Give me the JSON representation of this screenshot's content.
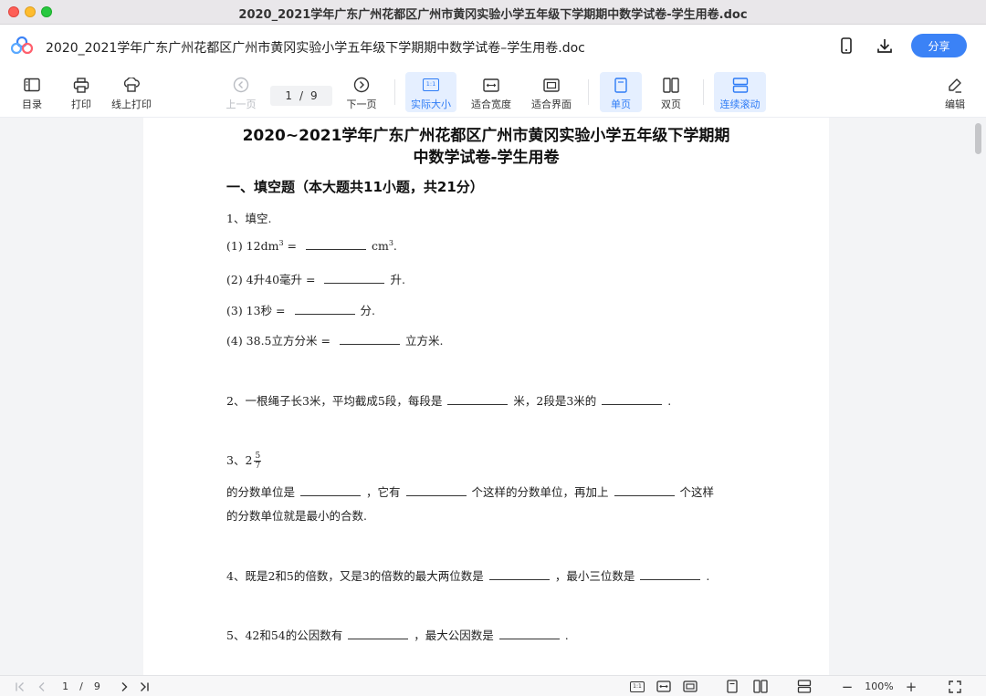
{
  "window": {
    "title": "2020_2021学年广东广州花都区广州市黄冈实验小学五年级下学期期中数学试卷-学生用卷.doc"
  },
  "header": {
    "doc_title": "2020_2021学年广东广州花都区广州市黄冈实验小学五年级下学期期中数学试卷–学生用卷.doc",
    "share_label": "分享",
    "accent": "#3b82f6"
  },
  "toolbar": {
    "toc_label": "目录",
    "print_label": "打印",
    "online_print_label": "线上打印",
    "prev_label": "上一页",
    "current_page": "1",
    "slash": "/",
    "total_pages": "9",
    "next_label": "下一页",
    "actual_size_label": "实际大小",
    "actual_size_badge": "1:1",
    "fit_width_label": "适合宽度",
    "fit_page_label": "适合界面",
    "single_page_label": "单页",
    "double_page_label": "双页",
    "continuous_label": "连续滚动",
    "edit_label": "编辑"
  },
  "document": {
    "title_line1": "2020~2021学年广东广州花都区广州市黄冈实验小学五年级下学期期",
    "title_line2": "中数学试卷-学生用卷",
    "section1": "一、填空题（本大题共11小题，共21分）",
    "q1": "1、填空.",
    "q1_1_pre": "(1) 12dm",
    "q1_1_sup": "3",
    "q1_1_eq": " = ",
    "q1_1_unit": "cm",
    "q1_1_unit_sup": "3",
    "q1_1_end": ".",
    "q1_2_pre": "(2) 4升40毫升 = ",
    "q1_2_post": "升.",
    "q1_3_pre": "(3) 13秒 = ",
    "q1_3_post": "分.",
    "q1_4_pre": "(4) 38.5立方分米 = ",
    "q1_4_post": "立方米.",
    "q2_pre": "2、一根绳子长3米，平均截成5段，每段是",
    "q2_mid": "米，2段是3米的",
    "q2_end": ".",
    "q3_pre": "3、2",
    "q3_num": "5",
    "q3_den": "7",
    "q3_line1_a": "的分数单位是",
    "q3_line1_b": "，它有",
    "q3_line1_c": "个这样的分数单位，再加上",
    "q3_line1_d": "个这样",
    "q3_line2": "的分数单位就是最小的合数.",
    "q4_pre": "4、既是2和5的倍数，又是3的倍数的最大两位数是",
    "q4_mid": "，最小三位数是",
    "q4_end": ".",
    "q5_pre": "5、42和54的公因数有",
    "q5_mid": "，最大公因数是",
    "q5_end": "."
  },
  "statusbar": {
    "current_page": "1",
    "slash": "/",
    "total_pages": "9",
    "actual_size_badge": "1:1",
    "zoom": "100%",
    "zoom_out": "−",
    "zoom_in": "+"
  }
}
